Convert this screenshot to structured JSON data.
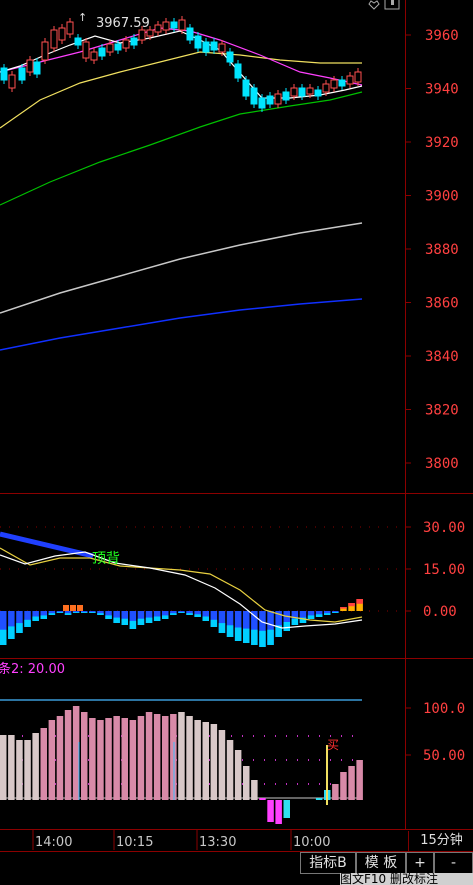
{
  "colors": {
    "background": "#000000",
    "frame": "#8b0000",
    "axis_text": "#ff4040",
    "candle_up": "#ff5050",
    "candle_down": "#00e5ff",
    "ma_white": "#ffffff",
    "ma_magenta": "#ff40ff",
    "ma_yellow": "#f0e060",
    "ma_green": "#00c000",
    "ma_gray": "#c8c8c8",
    "ma_blue": "#1030ff",
    "dif": "#ffffff",
    "dea": "#e8d040",
    "divergence": "#2040ff",
    "signal_text": "#20ff20",
    "osc_label": "#ff40ff",
    "osc_line": "#3a9ad8"
  },
  "price_panel": {
    "high_marker": "3967.59",
    "y_ticks": [
      "3960",
      "3940",
      "3920",
      "3900",
      "3880",
      "3860",
      "3840",
      "3820",
      "3800"
    ],
    "top_icons": [
      "heart-icon",
      "page-icon"
    ]
  },
  "macd_panel": {
    "y_ticks": [
      "30.00",
      "15.00",
      "0.00"
    ],
    "signal_text": "顶背"
  },
  "osc_panel": {
    "label": "条2: 20.00",
    "y_ticks": [
      "100.0",
      "50.00"
    ],
    "signal_text": "买"
  },
  "time_axis": {
    "labels": [
      "14:00",
      "10:15",
      "13:30",
      "10:00"
    ],
    "period": "15分钟"
  },
  "bottom_bar": {
    "indicator_tab": "指标B",
    "template_tab": "模 板",
    "plus": "+",
    "minus": "-",
    "status_text": "图文F10 删改标注"
  }
}
